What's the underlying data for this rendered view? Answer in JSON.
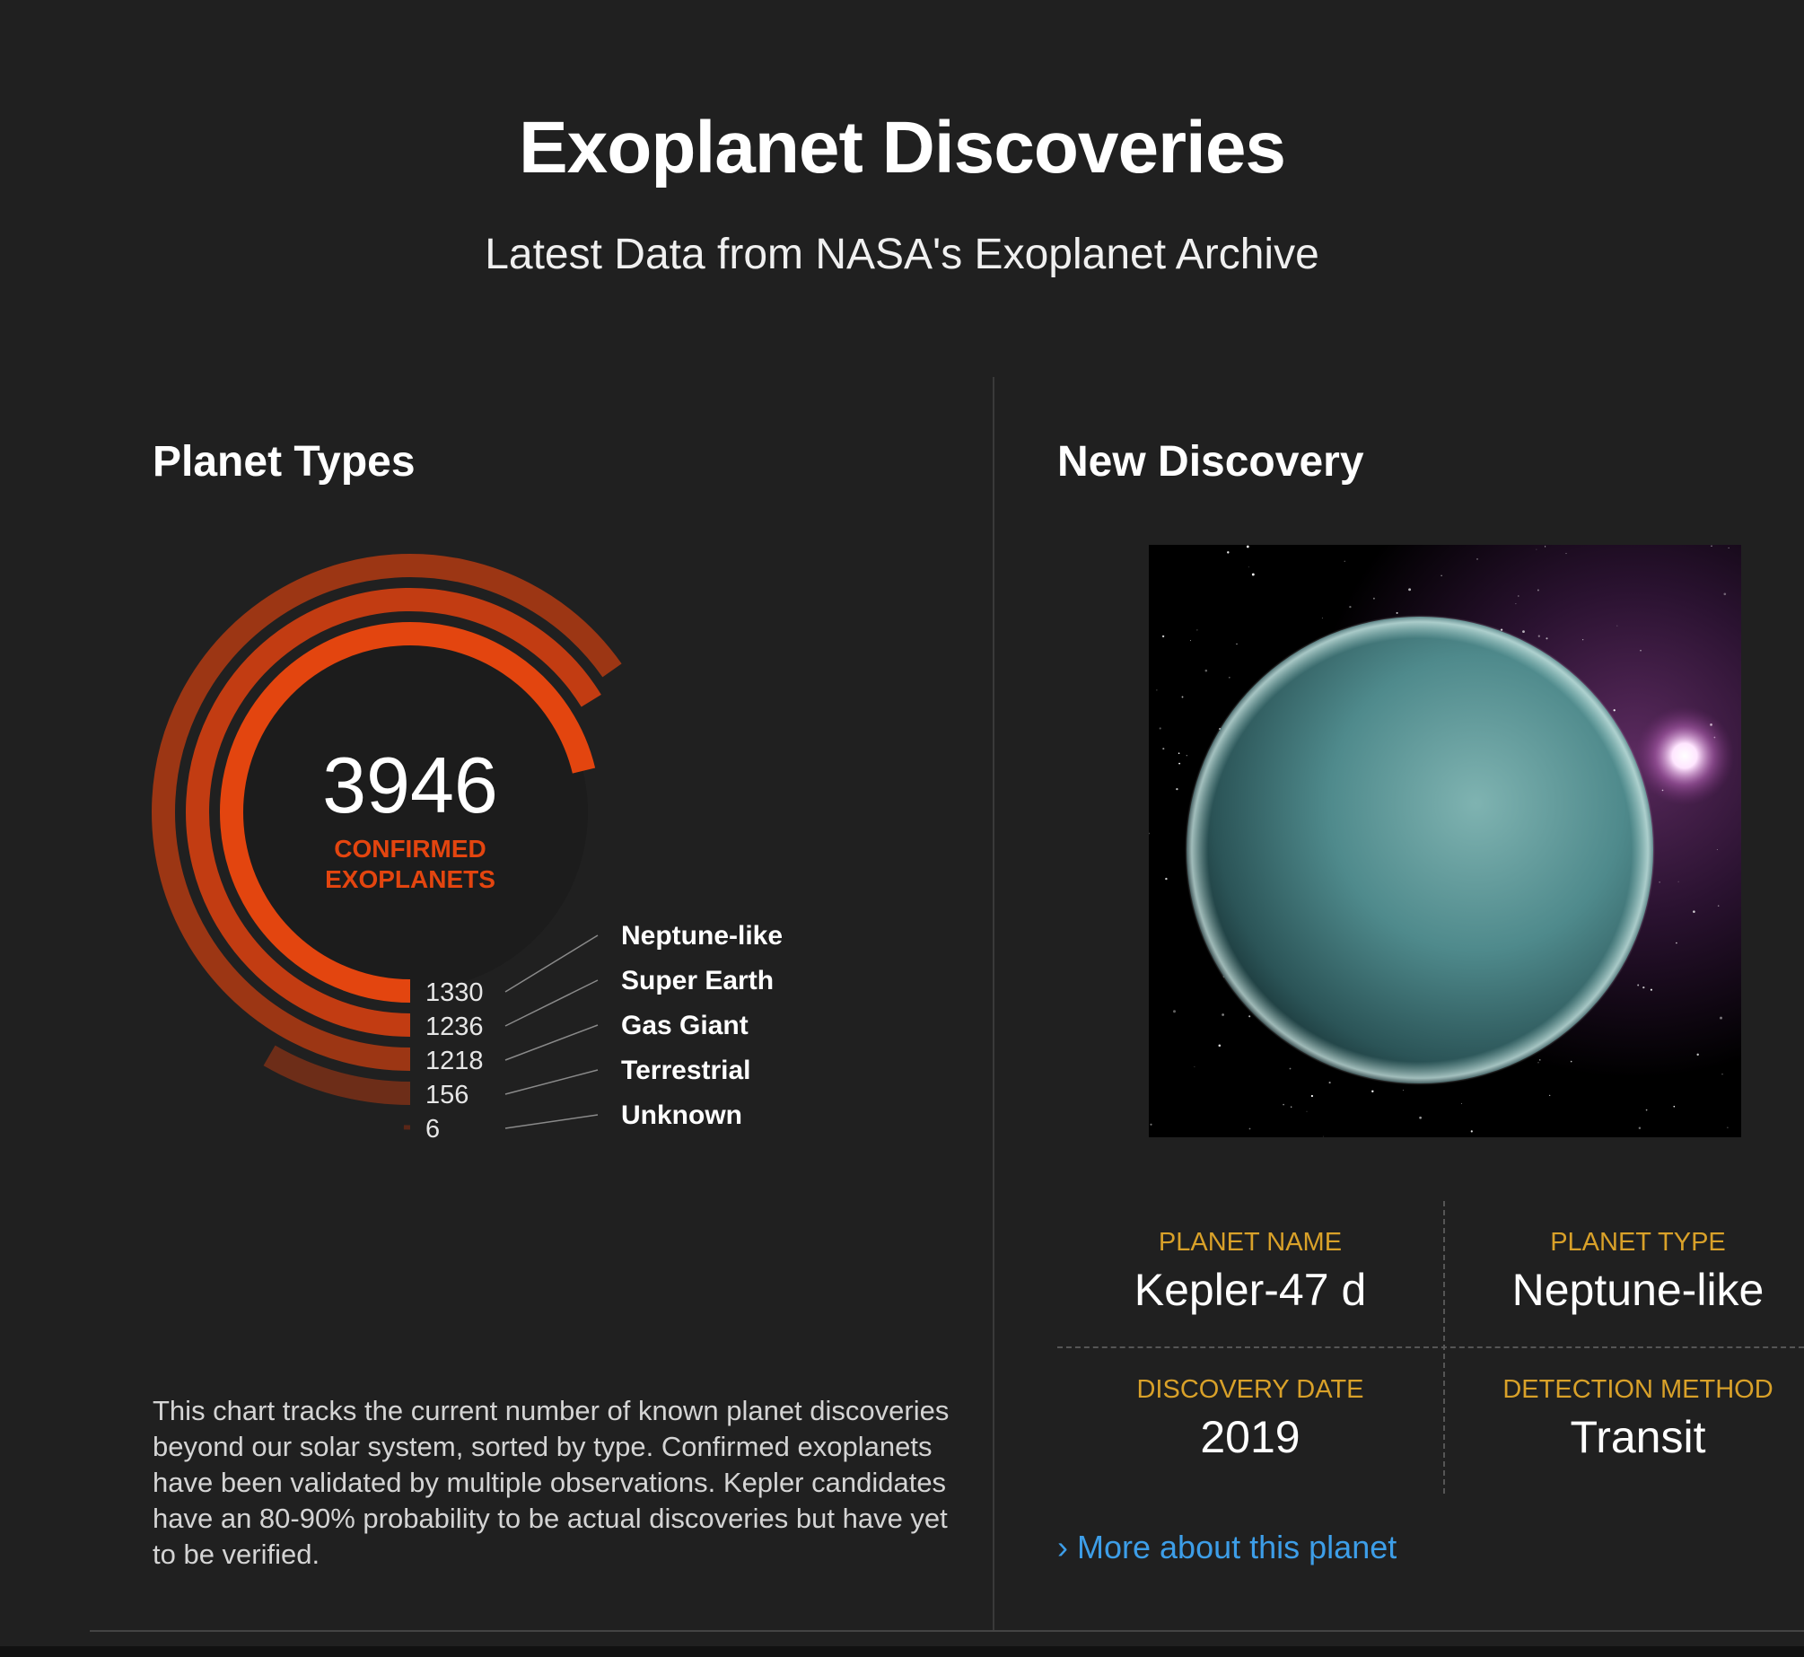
{
  "header": {
    "title": "Exoplanet Discoveries",
    "subtitle": "Latest Data from NASA's Exoplanet Archive"
  },
  "planet_types": {
    "heading": "Planet Types",
    "total": "3946",
    "total_label_line1": "CONFIRMED",
    "total_label_line2": "EXOPLANETS",
    "description": "This chart tracks the current number of known planet discoveries beyond our solar system, sorted by type. Confirmed exoplanets have been validated by multiple observations. Kepler candidates have an 80-90% probability to be actual discoveries but have yet to be verified."
  },
  "chart_data": {
    "type": "radial-bar",
    "total": 3946,
    "categories": [
      "Neptune-like",
      "Super Earth",
      "Gas Giant",
      "Terrestrial",
      "Unknown"
    ],
    "values": [
      1330,
      1236,
      1218,
      156,
      6
    ],
    "value_labels": [
      "1330",
      "1236",
      "1218",
      "156",
      "6"
    ],
    "colors": [
      "#e3450f",
      "#c23c12",
      "#9c3614",
      "#6d2d18",
      "#5a2617"
    ],
    "accent": "#e3450f"
  },
  "new_discovery": {
    "heading": "New Discovery",
    "planet_name_label": "PLANET NAME",
    "planet_name": "Kepler-47 d",
    "planet_type_label": "PLANET TYPE",
    "planet_type": "Neptune-like",
    "discovery_date_label": "DISCOVERY DATE",
    "discovery_date": "2019",
    "detection_method_label": "DETECTION METHOD",
    "detection_method": "Transit",
    "more_link_arrow": "›",
    "more_link": "More about this planet"
  },
  "colors": {
    "background": "#202020",
    "accent_orange": "#e3450f",
    "label_gold": "#d9a129",
    "link_blue": "#3d9ee8"
  }
}
